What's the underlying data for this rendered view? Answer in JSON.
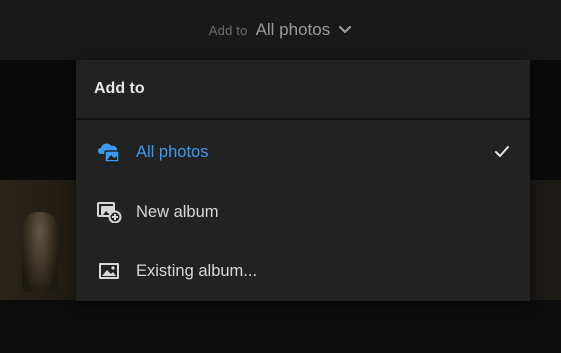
{
  "header": {
    "prefix": "Add to",
    "value": "All photos",
    "chevron_icon": "chevron-down-icon"
  },
  "menu": {
    "title": "Add to",
    "items": [
      {
        "label": "All photos",
        "icon": "cloud-photos-icon",
        "selected": true,
        "checkmark": "checkmark-icon"
      },
      {
        "label": "New album",
        "icon": "new-album-icon",
        "selected": false
      },
      {
        "label": "Existing album...",
        "icon": "album-icon",
        "selected": false
      }
    ]
  },
  "colors": {
    "accent": "#3b9bf0",
    "menu_bg": "#222222",
    "topbar_bg": "#191919",
    "text": "#d8d8d8"
  }
}
